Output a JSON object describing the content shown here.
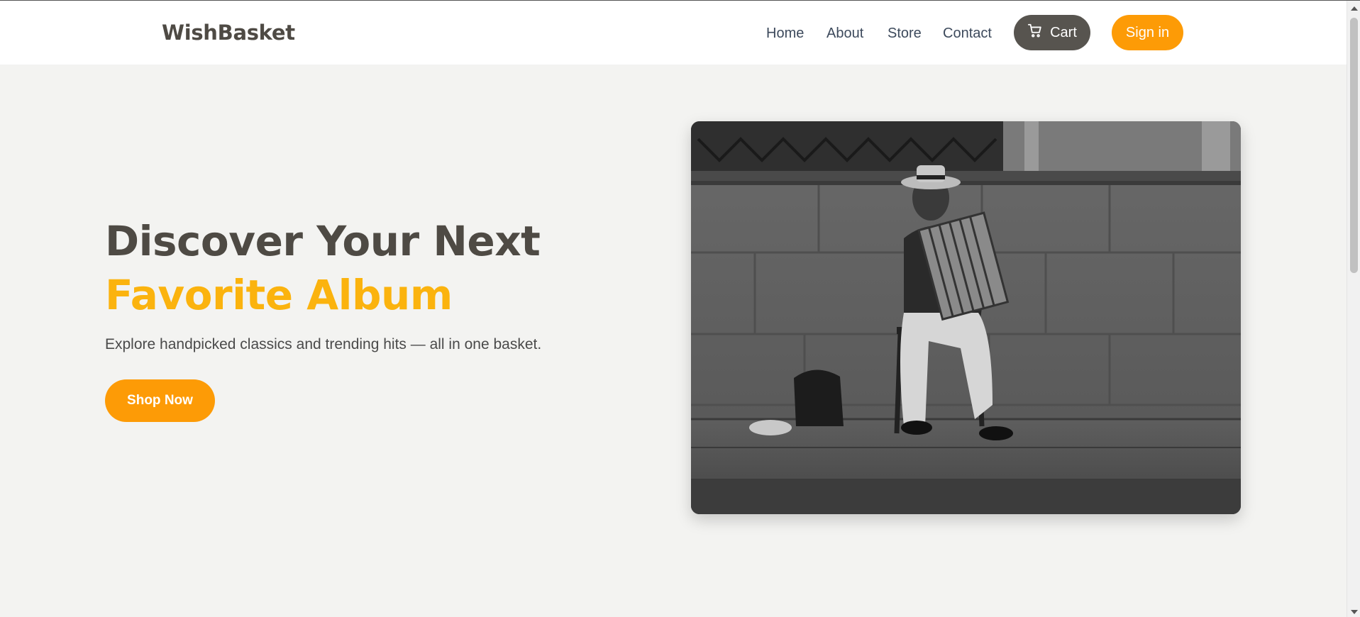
{
  "brand": {
    "name": "WishBasket"
  },
  "nav": {
    "home": "Home",
    "about": "About",
    "store": "Store",
    "contact": "Contact",
    "cart": "Cart",
    "sign_in": "Sign in"
  },
  "hero": {
    "title_line1": "Discover Your Next",
    "title_line2": "Favorite Album",
    "subtitle": "Explore handpicked classics and trending hits — all in one basket.",
    "cta": "Shop Now",
    "image": "street-accordion-player-photo"
  },
  "colors": {
    "accent_orange": "#fd9b06",
    "accent_yellow": "#fbb30e",
    "dark": "#57544f",
    "background": "#f3f3f1",
    "header_bg": "#ffffff"
  },
  "icons": {
    "cart": "shopping-cart-icon"
  }
}
